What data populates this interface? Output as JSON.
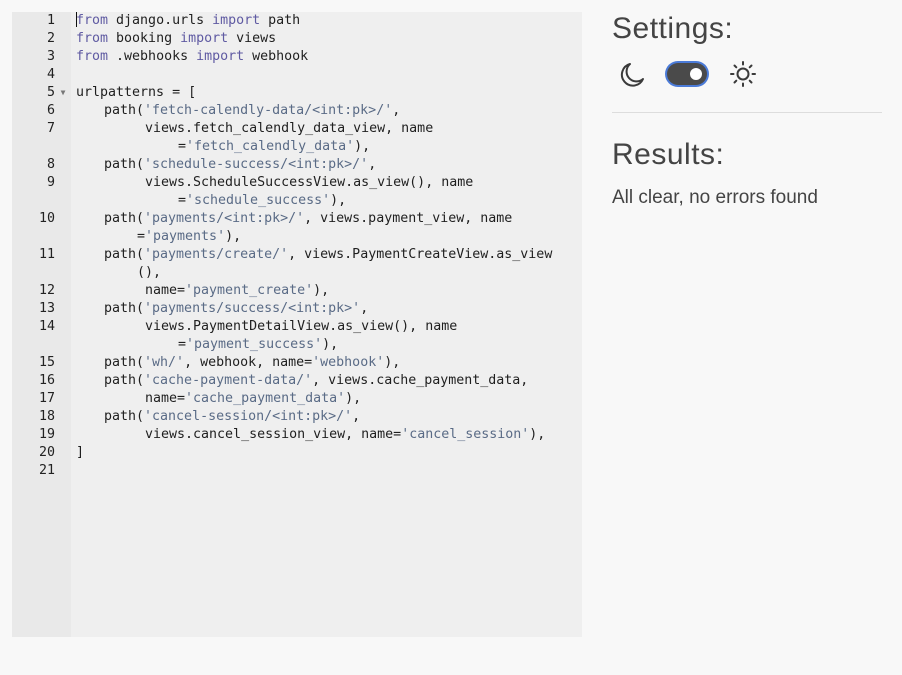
{
  "editor": {
    "lines": [
      {
        "n": "1",
        "segs": [
          [
            "kw",
            "from"
          ],
          [
            "t",
            " django.urls "
          ],
          [
            "kw",
            "import"
          ],
          [
            "t",
            " path"
          ]
        ],
        "cursor": true
      },
      {
        "n": "2",
        "segs": [
          [
            "kw",
            "from"
          ],
          [
            "t",
            " booking "
          ],
          [
            "kw",
            "import"
          ],
          [
            "t",
            " views"
          ]
        ]
      },
      {
        "n": "3",
        "segs": [
          [
            "kw",
            "from"
          ],
          [
            "t",
            " .webhooks "
          ],
          [
            "kw",
            "import"
          ],
          [
            "t",
            " webhook"
          ]
        ]
      },
      {
        "n": "4",
        "segs": []
      },
      {
        "n": "5",
        "segs": [
          [
            "t",
            "urlpatterns = ["
          ]
        ],
        "fold": true
      },
      {
        "n": "6",
        "indent": "indent1",
        "segs": [
          [
            "t",
            "path("
          ],
          [
            "str",
            "'fetch-calendly-data/<int:pk>/'"
          ],
          [
            "t",
            ","
          ]
        ]
      },
      {
        "n": "7",
        "indent": "indent2",
        "segs": [
          [
            "t",
            "views.fetch_calendly_data_view, name"
          ]
        ]
      },
      {
        "n": "",
        "indent": "wrap3",
        "segs": [
          [
            "t",
            "="
          ],
          [
            "str",
            "'fetch_calendly_data'"
          ],
          [
            "t",
            "),"
          ]
        ]
      },
      {
        "n": "8",
        "indent": "indent1",
        "segs": [
          [
            "t",
            "path("
          ],
          [
            "str",
            "'schedule-success/<int:pk>/'"
          ],
          [
            "t",
            ","
          ]
        ]
      },
      {
        "n": "9",
        "indent": "indent2",
        "segs": [
          [
            "t",
            "views.ScheduleSuccessView.as_view(), name"
          ]
        ]
      },
      {
        "n": "",
        "indent": "wrap3",
        "segs": [
          [
            "t",
            "="
          ],
          [
            "str",
            "'schedule_success'"
          ],
          [
            "t",
            "),"
          ]
        ]
      },
      {
        "n": "10",
        "indent": "indent1",
        "segs": [
          [
            "t",
            "path("
          ],
          [
            "str",
            "'payments/<int:pk>/'"
          ],
          [
            "t",
            ", views.payment_view, name"
          ]
        ]
      },
      {
        "n": "",
        "indent": "wrap2",
        "segs": [
          [
            "t",
            "="
          ],
          [
            "str",
            "'payments'"
          ],
          [
            "t",
            "),"
          ]
        ]
      },
      {
        "n": "11",
        "indent": "indent1",
        "segs": [
          [
            "t",
            "path("
          ],
          [
            "str",
            "'payments/create/'"
          ],
          [
            "t",
            ", views.PaymentCreateView.as_view"
          ]
        ]
      },
      {
        "n": "",
        "indent": "wrap2",
        "segs": [
          [
            "t",
            "(),"
          ]
        ]
      },
      {
        "n": "12",
        "indent": "indent2",
        "segs": [
          [
            "t",
            "name="
          ],
          [
            "str",
            "'payment_create'"
          ],
          [
            "t",
            "),"
          ]
        ]
      },
      {
        "n": "13",
        "indent": "indent1",
        "segs": [
          [
            "t",
            "path("
          ],
          [
            "str",
            "'payments/success/<int:pk>'"
          ],
          [
            "t",
            ","
          ]
        ]
      },
      {
        "n": "14",
        "indent": "indent2",
        "segs": [
          [
            "t",
            "views.PaymentDetailView.as_view(), name"
          ]
        ]
      },
      {
        "n": "",
        "indent": "wrap3",
        "segs": [
          [
            "t",
            "="
          ],
          [
            "str",
            "'payment_success'"
          ],
          [
            "t",
            "),"
          ]
        ]
      },
      {
        "n": "15",
        "indent": "indent1",
        "segs": [
          [
            "t",
            "path("
          ],
          [
            "str",
            "'wh/'"
          ],
          [
            "t",
            ", webhook, name="
          ],
          [
            "str",
            "'webhook'"
          ],
          [
            "t",
            "),"
          ]
        ]
      },
      {
        "n": "16",
        "indent": "indent1",
        "segs": [
          [
            "t",
            "path("
          ],
          [
            "str",
            "'cache-payment-data/'"
          ],
          [
            "t",
            ", views.cache_payment_data,"
          ]
        ]
      },
      {
        "n": "17",
        "indent": "indent2",
        "segs": [
          [
            "t",
            "name="
          ],
          [
            "str",
            "'cache_payment_data'"
          ],
          [
            "t",
            "),"
          ]
        ]
      },
      {
        "n": "18",
        "indent": "indent1",
        "segs": [
          [
            "t",
            "path("
          ],
          [
            "str",
            "'cancel-session/<int:pk>/'"
          ],
          [
            "t",
            ","
          ]
        ]
      },
      {
        "n": "19",
        "indent": "indent2",
        "segs": [
          [
            "t",
            "views.cancel_session_view, name="
          ],
          [
            "str",
            "'cancel_session'"
          ],
          [
            "t",
            "),"
          ]
        ]
      },
      {
        "n": "20",
        "segs": [
          [
            "t",
            "]"
          ]
        ]
      },
      {
        "n": "21",
        "segs": []
      }
    ]
  },
  "settings": {
    "title": "Settings:",
    "dark_icon": "moon-icon",
    "light_icon": "sun-icon",
    "theme_toggle_on": true
  },
  "results": {
    "title": "Results:",
    "message": "All clear, no errors found"
  },
  "colors": {
    "keyword": "#5f5aa2",
    "string": "#5a6b86",
    "toggle_focus": "#4b7bd8"
  }
}
